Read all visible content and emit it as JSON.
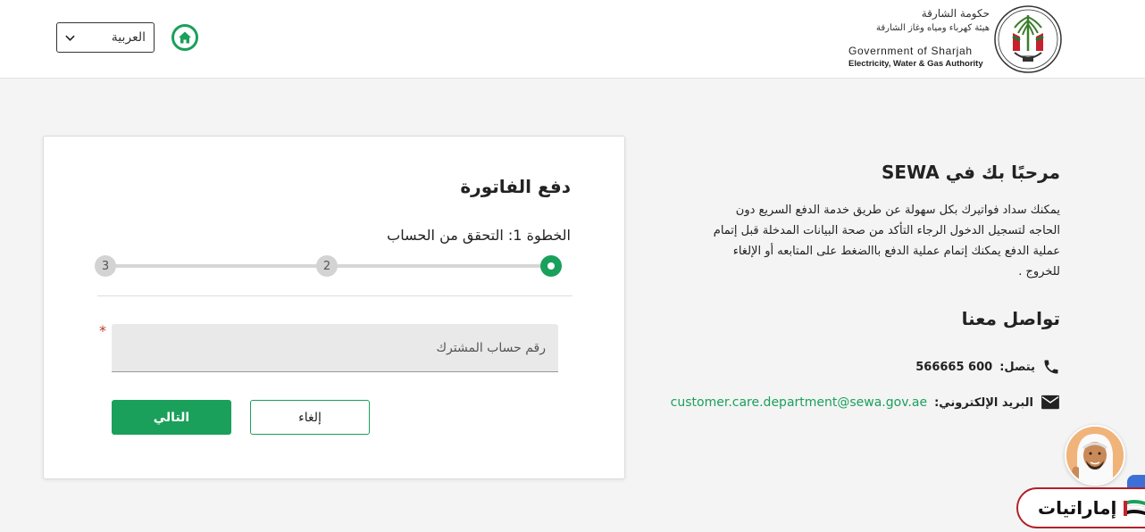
{
  "header": {
    "language_selected": "العربية",
    "logo": {
      "arabic_line1": "حكومة الشارقة",
      "arabic_line2": "هيئة كهرباء ومياه وغاز الشارقة",
      "english_line1": "Government of Sharjah",
      "english_line2": "Electricity, Water & Gas Authority"
    }
  },
  "form": {
    "title": "دفع الفاتورة",
    "step_label": "الخطوة 1: التحقق من الحساب",
    "steps": [
      "1",
      "2",
      "3"
    ],
    "current_step": 1,
    "account_placeholder": "رقم حساب المشترك",
    "required_mark": "*",
    "next_label": "التالي",
    "cancel_label": "إلغاء"
  },
  "info": {
    "welcome_title": "مرحبًا بك في SEWA",
    "welcome_body": "يمكنك سداد فواتيرك بكل سهولة عن طريق خدمة الدفع السريع دون الحاجه لتسجيل الدخول الرجاء التأكد من صحة البيانات المدخلة قبل إتمام عملية الدفع يمكنك إتمام عملية الدفع باالضغط على المتابعه أو الإلغاء للخروج .",
    "contact_title": "تواصل معنا",
    "phone_label": "يتصل:",
    "phone_value": "566665 600",
    "email_label": "البريد الإلكتروني:",
    "email_value": "customer.care.department@sewa.gov.ae"
  },
  "assistant": {
    "badge_text": "إماراتيات"
  },
  "colors": {
    "accent_green": "#1aa05a",
    "badge_red": "#b3202a"
  }
}
